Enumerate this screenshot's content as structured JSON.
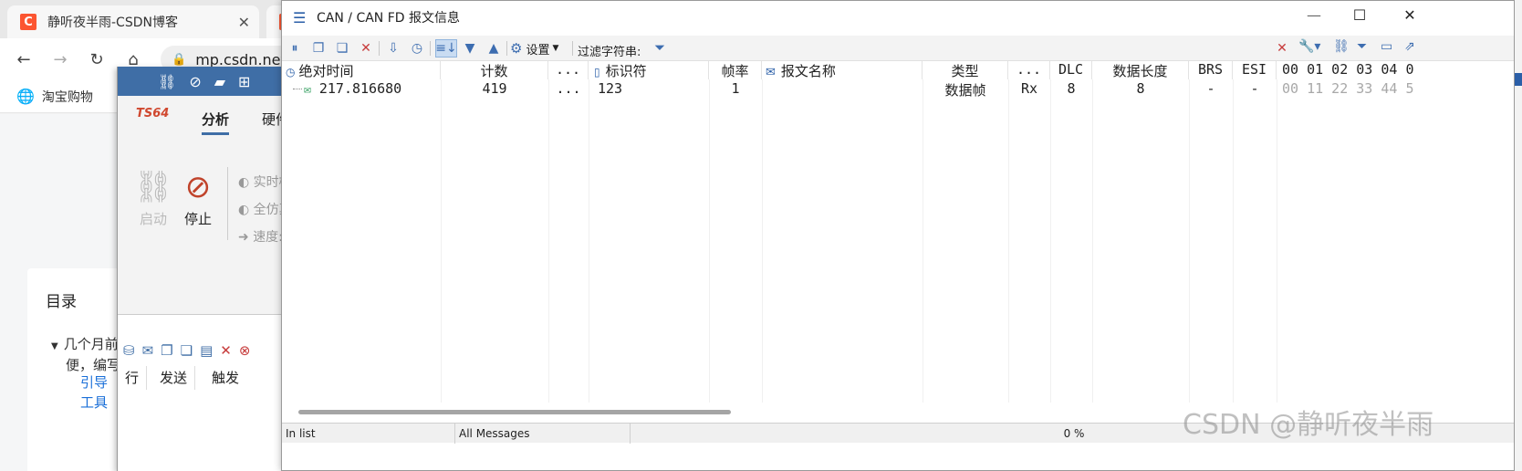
{
  "browser": {
    "tab1_title": "静听夜半雨-CSDN博客",
    "tab_close": "✕",
    "logo_letter": "C",
    "url": "mp.csdn.net",
    "bookmark": "淘宝购物",
    "toc_title": "目录",
    "toc_item1": "几个月前",
    "toc_item1b": "便，编写",
    "toc_link1": "引导",
    "toc_link2": "工具"
  },
  "analysis_app": {
    "logo_text": "TS64",
    "tab_analysis": "分析",
    "tab_hardware": "硬件",
    "start_label": "启动",
    "stop_label": "停止",
    "opt_realtime": "实时模",
    "opt_fullsim": "全仿真",
    "opt_speed": "速度:",
    "col_row": "行",
    "col_send": "发送",
    "col_trigger": "触发"
  },
  "can_window": {
    "title": "CAN / CAN FD 报文信息",
    "settings_label": "设置",
    "filter_label": "过滤字符串:",
    "columns": {
      "abs_time": "绝对时间",
      "count": "计数",
      "ellipsis1": "...",
      "identifier": "标识符",
      "frame_rate": "帧率",
      "msg_name": "报文名称",
      "type": "类型",
      "ellipsis2": "...",
      "dlc": "DLC",
      "data_length": "数据长度",
      "brs": "BRS",
      "esi": "ESI",
      "data_bytes": "00 01 02 03 04 0"
    },
    "row": {
      "abs_time": "217.816680",
      "count": "419",
      "ellipsis": "...",
      "identifier": "123",
      "frame_rate": "1",
      "msg_name": "",
      "type": "数据帧",
      "dir": "Rx",
      "dlc": "8",
      "data_length": "8",
      "brs": "-",
      "esi": "-",
      "data": "00 11 22 33 44 5"
    },
    "status": {
      "in_list": "In list",
      "all_messages": "All Messages",
      "progress": "0 %"
    }
  },
  "watermark": "CSDN @静听夜半雨"
}
